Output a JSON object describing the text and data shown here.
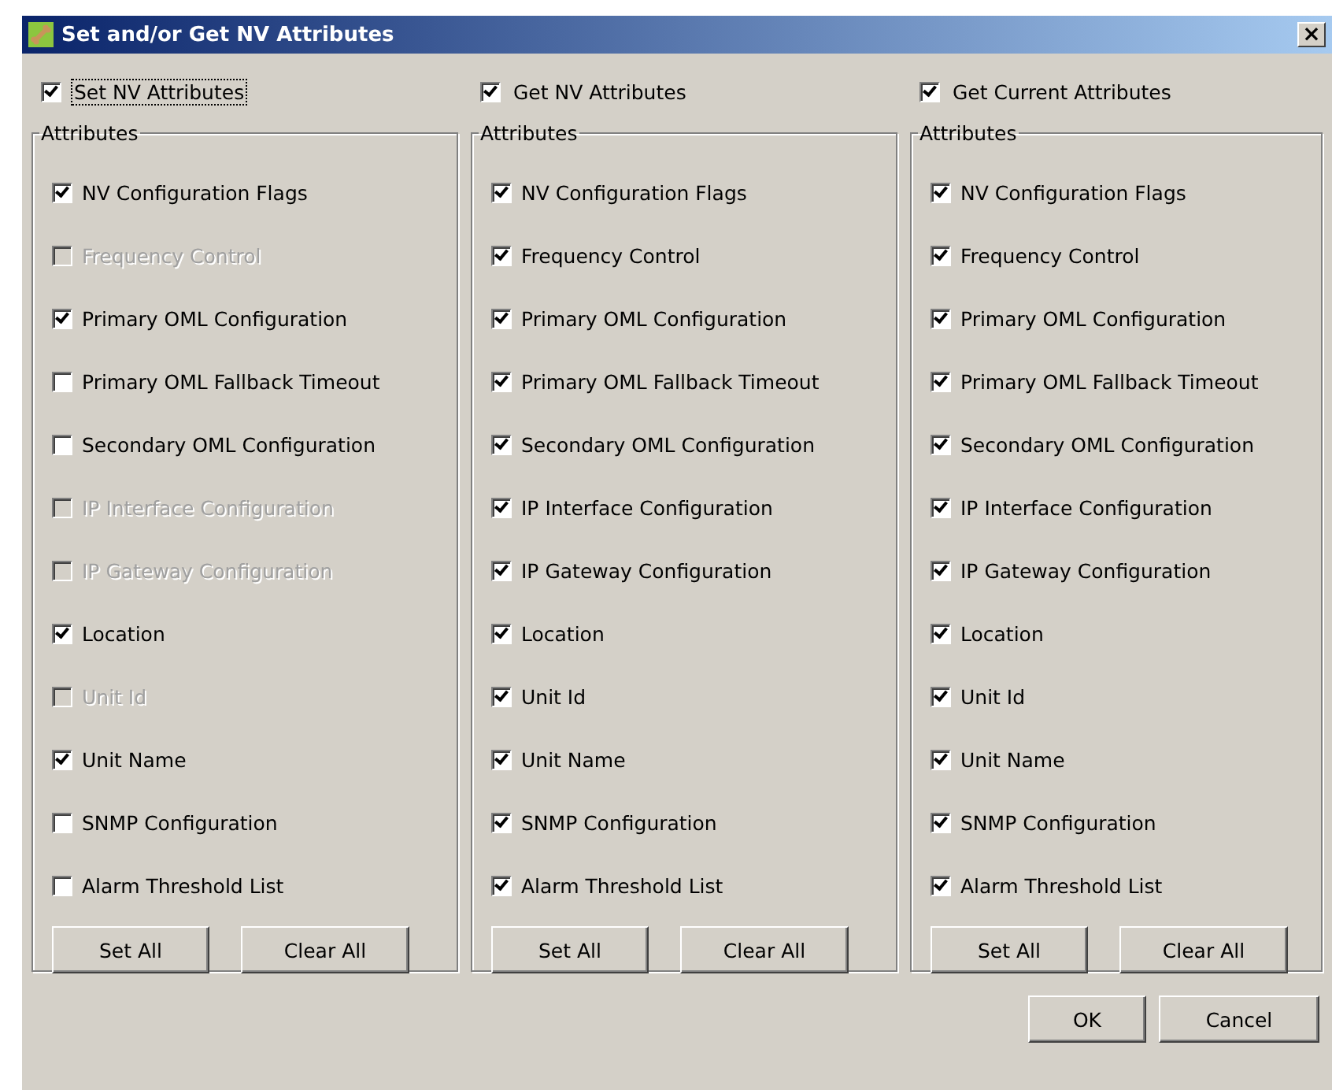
{
  "window": {
    "title": "Set and/or Get NV Attributes",
    "close": "×"
  },
  "columns": [
    {
      "header": {
        "label": "Set NV Attributes",
        "checked": true,
        "focused": true
      },
      "group_title": "Attributes",
      "items": [
        {
          "label": "NV Configuration Flags",
          "checked": true,
          "disabled": false
        },
        {
          "label": "Frequency Control",
          "checked": false,
          "disabled": true
        },
        {
          "label": "Primary OML Configuration",
          "checked": true,
          "disabled": false
        },
        {
          "label": "Primary OML Fallback Timeout",
          "checked": false,
          "disabled": false
        },
        {
          "label": "Secondary OML Configuration",
          "checked": false,
          "disabled": false
        },
        {
          "label": "IP Interface Configuration",
          "checked": false,
          "disabled": true
        },
        {
          "label": "IP Gateway Configuration",
          "checked": false,
          "disabled": true
        },
        {
          "label": "Location",
          "checked": true,
          "disabled": false
        },
        {
          "label": "Unit Id",
          "checked": false,
          "disabled": true
        },
        {
          "label": "Unit Name",
          "checked": true,
          "disabled": false
        },
        {
          "label": "SNMP Configuration",
          "checked": false,
          "disabled": false
        },
        {
          "label": "Alarm Threshold List",
          "checked": false,
          "disabled": false
        }
      ],
      "buttons": [
        "Set All",
        "Clear All"
      ]
    },
    {
      "header": {
        "label": "Get NV Attributes",
        "checked": true,
        "focused": false
      },
      "group_title": "Attributes",
      "items": [
        {
          "label": "NV Configuration Flags",
          "checked": true,
          "disabled": false
        },
        {
          "label": "Frequency Control",
          "checked": true,
          "disabled": false
        },
        {
          "label": "Primary OML Configuration",
          "checked": true,
          "disabled": false
        },
        {
          "label": "Primary OML Fallback Timeout",
          "checked": true,
          "disabled": false
        },
        {
          "label": "Secondary OML Configuration",
          "checked": true,
          "disabled": false
        },
        {
          "label": "IP Interface Configuration",
          "checked": true,
          "disabled": false
        },
        {
          "label": "IP Gateway Configuration",
          "checked": true,
          "disabled": false
        },
        {
          "label": "Location",
          "checked": true,
          "disabled": false
        },
        {
          "label": "Unit Id",
          "checked": true,
          "disabled": false
        },
        {
          "label": "Unit Name",
          "checked": true,
          "disabled": false
        },
        {
          "label": "SNMP Configuration",
          "checked": true,
          "disabled": false
        },
        {
          "label": "Alarm Threshold List",
          "checked": true,
          "disabled": false
        }
      ],
      "buttons": [
        "Set All",
        "Clear All"
      ]
    },
    {
      "header": {
        "label": "Get Current Attributes",
        "checked": true,
        "focused": false
      },
      "group_title": "Attributes",
      "items": [
        {
          "label": "NV Configuration Flags",
          "checked": true,
          "disabled": false
        },
        {
          "label": "Frequency Control",
          "checked": true,
          "disabled": false
        },
        {
          "label": "Primary OML Configuration",
          "checked": true,
          "disabled": false
        },
        {
          "label": "Primary OML Fallback Timeout",
          "checked": true,
          "disabled": false
        },
        {
          "label": "Secondary OML Configuration",
          "checked": true,
          "disabled": false
        },
        {
          "label": "IP Interface Configuration",
          "checked": true,
          "disabled": false
        },
        {
          "label": "IP Gateway Configuration",
          "checked": true,
          "disabled": false
        },
        {
          "label": "Location",
          "checked": true,
          "disabled": false
        },
        {
          "label": "Unit Id",
          "checked": true,
          "disabled": false
        },
        {
          "label": "Unit Name",
          "checked": true,
          "disabled": false
        },
        {
          "label": "SNMP Configuration",
          "checked": true,
          "disabled": false
        },
        {
          "label": "Alarm Threshold List",
          "checked": true,
          "disabled": false
        }
      ],
      "buttons": [
        "Set All",
        "Clear All"
      ]
    }
  ],
  "footer_buttons": [
    "OK",
    "Cancel"
  ]
}
